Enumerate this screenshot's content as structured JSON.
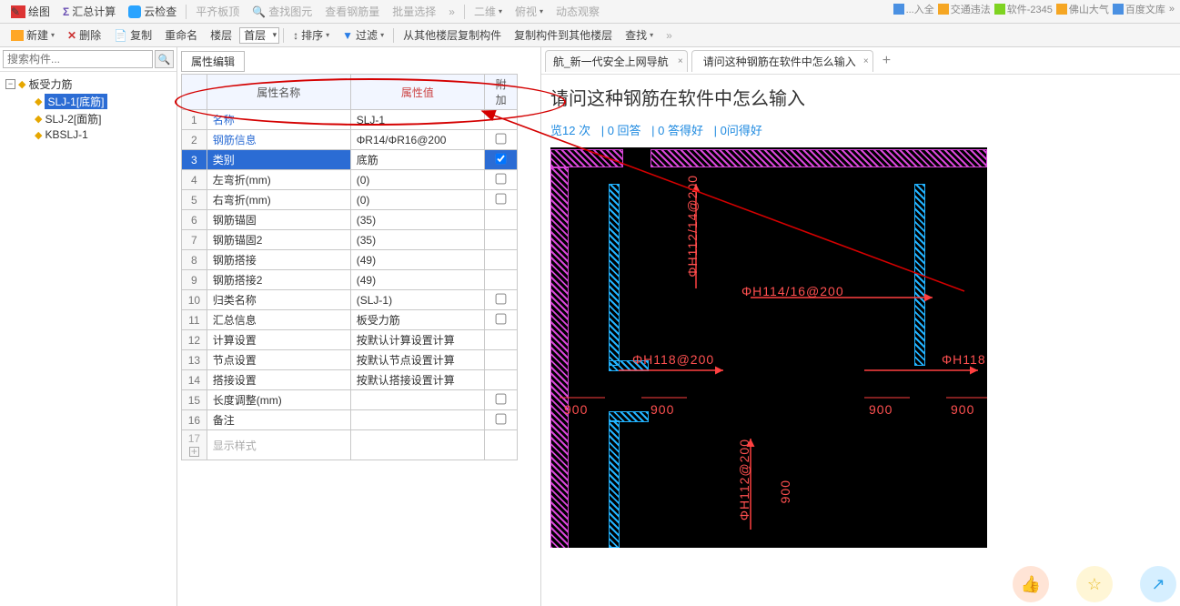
{
  "top_toolbar1": {
    "btn_paint": "绘图",
    "btn_sum": "汇总计算",
    "btn_cloud": "云检查",
    "btn_align_top": "平齐板顶",
    "btn_find": "查找图元",
    "btn_rebar": "查看钢筋量",
    "btn_batch": "批量选择",
    "expand": "»",
    "btn_2d": "二维",
    "btn_top": "俯视",
    "btn_dynobs": "动态观察"
  },
  "small_tabs": [
    "...入全",
    "交通违法",
    "软件-2345",
    "佛山大气",
    "百度文库"
  ],
  "top_toolbar2": {
    "btn_new": "新建",
    "btn_del": "删除",
    "btn_copy": "复制",
    "btn_rename": "重命名",
    "lbl_floor": "楼层",
    "combo_floor": "首层",
    "btn_sort": "排序",
    "btn_filter": "过滤",
    "btn_copyfrom": "从其他楼层复制构件",
    "btn_copyto": "复制构件到其他楼层",
    "btn_search": "查找"
  },
  "search_placeholder": "搜索构件...",
  "tree": {
    "root": "板受力筋",
    "children": [
      "SLJ-1[底筋]",
      "SLJ-2[面筋]",
      "KBSLJ-1"
    ]
  },
  "prop_tab": "属性编辑",
  "prop_headers": {
    "name": "属性名称",
    "value": "属性值",
    "extra": "附加"
  },
  "properties": [
    {
      "n": "名称",
      "v": "SLJ-1",
      "blue": true,
      "chk": false
    },
    {
      "n": "钢筋信息",
      "v": "ΦR14/ΦR16@200",
      "blue": true,
      "chk": true
    },
    {
      "n": "类别",
      "v": "底筋",
      "blue": true,
      "sel": true,
      "chk": true,
      "checked": true
    },
    {
      "n": "左弯折(mm)",
      "v": "(0)",
      "chk": true
    },
    {
      "n": "右弯折(mm)",
      "v": "(0)",
      "chk": true
    },
    {
      "n": "钢筋锚固",
      "v": "(35)",
      "chk": false
    },
    {
      "n": "钢筋锚固2",
      "v": "(35)",
      "chk": false
    },
    {
      "n": "钢筋搭接",
      "v": "(49)",
      "chk": false
    },
    {
      "n": "钢筋搭接2",
      "v": "(49)",
      "chk": false
    },
    {
      "n": "归类名称",
      "v": "(SLJ-1)",
      "chk": true
    },
    {
      "n": "汇总信息",
      "v": "板受力筋",
      "chk": true
    },
    {
      "n": "计算设置",
      "v": "按默认计算设置计算",
      "chk": false
    },
    {
      "n": "节点设置",
      "v": "按默认节点设置计算",
      "chk": false
    },
    {
      "n": "搭接设置",
      "v": "按默认搭接设置计算",
      "chk": false
    },
    {
      "n": "长度调整(mm)",
      "v": "",
      "chk": true
    },
    {
      "n": "备注",
      "v": "",
      "chk": true
    }
  ],
  "prop_last": "显示样式",
  "browser": {
    "tab1": "航_新一代安全上网导航",
    "tab2": "请问这种钢筋在软件中怎么输入"
  },
  "page": {
    "title": "请问这种钢筋在软件中怎么输入",
    "meta_parts": [
      "览12 次",
      "| 0 回答",
      "| 0 答得好",
      "| 0问得好"
    ]
  },
  "cad": {
    "t1": "ΦH112/14@200",
    "t2": "ΦH114/16@200",
    "t3": "ΦH118@200",
    "t4": "ΦH112@200",
    "d900": "900",
    "t_right": "ΦH118"
  }
}
